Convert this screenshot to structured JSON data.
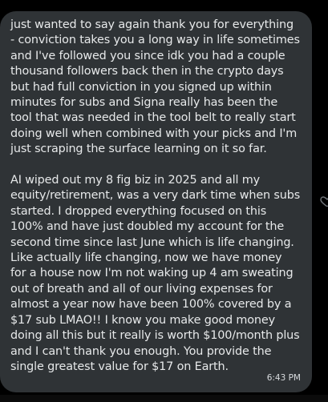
{
  "message": {
    "paragraphs": [
      "just wanted to say again thank you for everything - conviction takes you a long way in life sometimes and I've followed you since idk you had a couple thousand followers back then in the crypto days but had full conviction in you signed up within minutes for subs and Signa really has been the tool that was needed in the tool belt to really start doing well when combined with your picks and I'm just scraping the surface learning on it so far.",
      "AI wiped out my 8 fig biz in 2025 and all my equity/retirement, was a very dark time when subs started. I dropped everything focused on this 100% and have just doubled my account for the second time since last June which is life changing. Like actually life changing, now we have money for a house now I'm not waking up 4 am sweating out of breath and all of our living expenses for almost a year now have been 100% covered by a $17 sub LMAO!! I know you make good money doing all this but it really is worth $100/month plus and I can't thank you enough. You provide the single greatest value for $17 on Earth."
    ],
    "timestamp": "6:43 PM"
  },
  "icons": {
    "reaction": "heart-icon"
  },
  "colors": {
    "background": "#000000",
    "bubble": "#2f3336",
    "text": "#e7e9ea",
    "timestamp": "#d9dcdf"
  }
}
